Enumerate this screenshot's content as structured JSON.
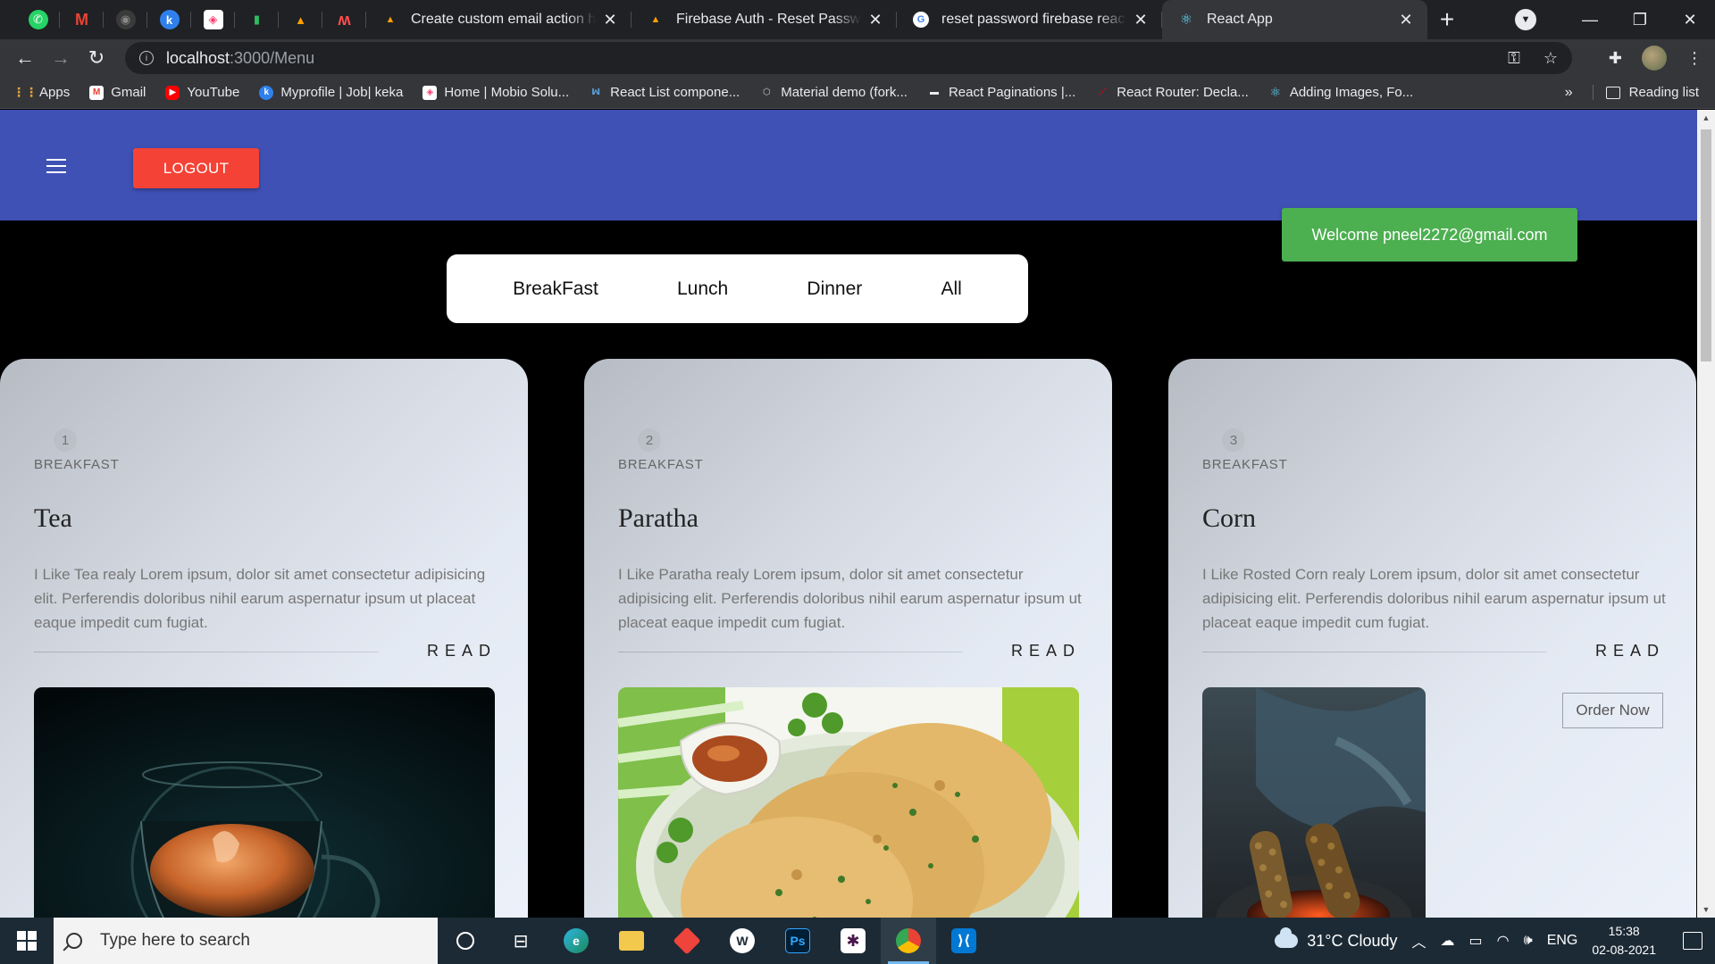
{
  "browser": {
    "pinned_tabs": [
      {
        "icon": "whatsapp-icon",
        "color": "#25d366",
        "glyph": "✆"
      },
      {
        "icon": "gmail-icon",
        "color": "#ea4335",
        "glyph": "M"
      },
      {
        "icon": "github-icon",
        "color": "#3a3a3a",
        "glyph": "◉"
      },
      {
        "icon": "keka-icon",
        "color": "#2f80ed",
        "glyph": "k"
      },
      {
        "icon": "mobio-icon",
        "color": "#ff3d71",
        "glyph": "◈"
      },
      {
        "icon": "evernote-icon",
        "color": "#2dbe60",
        "glyph": "▮"
      },
      {
        "icon": "firebase-icon",
        "color": "#ffa000",
        "glyph": "▲"
      },
      {
        "icon": "monday-icon",
        "color": "#ff4d4d",
        "glyph": "ʍ"
      }
    ],
    "tabs": [
      {
        "title": "Create custom email action hand",
        "icon": "firebase-icon",
        "color": "#ffa000",
        "active": false
      },
      {
        "title": "Firebase Auth - Reset Password (",
        "icon": "firebase-icon",
        "color": "#ffa000",
        "active": false
      },
      {
        "title": "reset password firebase react - G",
        "icon": "google-icon",
        "color": "#ffffff",
        "active": false
      },
      {
        "title": "React App",
        "icon": "react-icon",
        "color": "#61dafb",
        "active": true
      }
    ],
    "new_tab": "+",
    "url_host": "localhost",
    "url_path": ":3000/Menu",
    "bookmarks": [
      {
        "label": "Apps",
        "icon": "apps-grid-icon",
        "color": "#e8a33d"
      },
      {
        "label": "Gmail",
        "icon": "gmail-icon",
        "color": "#ea4335"
      },
      {
        "label": "YouTube",
        "icon": "youtube-icon",
        "color": "#ff0000"
      },
      {
        "label": "Myprofile | Job| keka",
        "icon": "keka-icon",
        "color": "#2f80ed"
      },
      {
        "label": "Home | Mobio Solu...",
        "icon": "mobio-icon",
        "color": "#ff3d71"
      },
      {
        "label": "React List compone...",
        "icon": "codesandbox-icon",
        "color": "#5b9bd5"
      },
      {
        "label": "Material demo (fork...",
        "icon": "codesandbox-icon",
        "color": "#9aa0a6"
      },
      {
        "label": "React Paginations |...",
        "icon": "bookmark-icon",
        "color": "#444444"
      },
      {
        "label": "React Router: Decla...",
        "icon": "react-router-icon",
        "color": "#d0021b"
      },
      {
        "label": "Adding Images, Fo...",
        "icon": "react-icon",
        "color": "#61dafb"
      }
    ],
    "bookmarks_more": "»",
    "reading_list": "Reading list"
  },
  "app": {
    "logout_label": "LOGOUT",
    "welcome_text": "Welcome pneel2272@gmail.com",
    "filters": [
      "BreakFast",
      "Lunch",
      "Dinner",
      "All"
    ],
    "accent_color": "#3f51b5",
    "logout_color": "#f44336",
    "welcome_color": "#4caf50"
  },
  "menu": {
    "read_label": "READ",
    "order_label": "Order Now",
    "items": [
      {
        "id": "1",
        "category": "BREAKFAST",
        "title": "Tea",
        "description": "I Like Tea realy Lorem ipsum, dolor sit amet consectetur adipisicing elit. Perferendis doloribus nihil earum aspernatur ipsum ut placeat eaque impedit cum fugiat.",
        "image": "tea-photo"
      },
      {
        "id": "2",
        "category": "BREAKFAST",
        "title": "Paratha",
        "description": "I Like Paratha realy Lorem ipsum, dolor sit amet consectetur adipisicing elit. Perferendis doloribus nihil earum aspernatur ipsum ut placeat eaque impedit cum fugiat.",
        "image": "paratha-photo"
      },
      {
        "id": "3",
        "category": "BREAKFAST",
        "title": "Corn",
        "description": "I Like Rosted Corn realy Lorem ipsum, dolor sit amet consectetur adipisicing elit. Perferendis doloribus nihil earum aspernatur ipsum ut placeat eaque impedit cum fugiat.",
        "image": "corn-photo"
      }
    ]
  },
  "taskbar": {
    "search_placeholder": "Type here to search",
    "weather": "31°C  Cloudy",
    "language": "ENG",
    "time": "15:38",
    "date": "02-08-2021"
  }
}
